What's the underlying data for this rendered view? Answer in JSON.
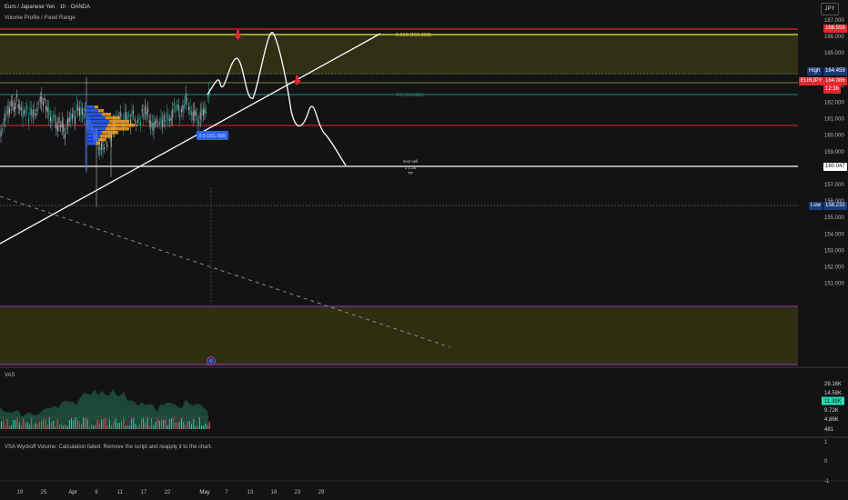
{
  "header": {
    "title": "Euro / Japanese Yen · 1h · OANDA",
    "subtitle": "Volume Profile / Fixed Range",
    "currency": "JPY"
  },
  "price_axis": {
    "ticks": [
      "167.000",
      "166.000",
      "165.000",
      "164.000",
      "163.000",
      "162.000",
      "161.000",
      "160.000",
      "159.000",
      "158.000",
      "157.000",
      "156.000",
      "155.000",
      "154.000",
      "153.000",
      "152.000",
      "151.000"
    ],
    "tags": {
      "top_red": "166.558",
      "high_label": "High",
      "high_value": "164.459",
      "symbol": "EURJPY",
      "current": "164.086",
      "countdown": "12:36",
      "level_160": "160.047",
      "low_label": "Low",
      "low_value": "158.232"
    }
  },
  "annotations": {
    "fib618": "0.618 (166.258)",
    "fib05": "0.5 (163.426)",
    "blue_box": "0.5 (161.988)",
    "note1": "next sell",
    "note2": "1 1.25",
    "note3": "TP"
  },
  "vas": {
    "label": "VAS",
    "axis": [
      "29.16K",
      "14.58K",
      "11.39K",
      "9.72K",
      "4.86K",
      "481"
    ]
  },
  "vsa": {
    "message": "VSA Wyckoff Volume: Calculation failed. Remove the script and reapply it to the chart.",
    "axis": [
      "1",
      "0",
      "-1"
    ]
  },
  "time_axis": [
    "19",
    "25",
    "Apr",
    "6",
    "11",
    "17",
    "22",
    "May",
    "7",
    "13",
    "18",
    "23",
    "29"
  ],
  "colors": {
    "background": "#131313",
    "bull": "#26a69a",
    "bear": "#ef5350",
    "fib_yellow": "#dfe04a",
    "fib_teal": "#1e8c85",
    "line_red": "#e0282e",
    "profile_blue": "#2962ff",
    "profile_orange": "#f7a21b",
    "zone_olive": "#3b3a17",
    "zone_purple": "#b23ec9"
  }
}
